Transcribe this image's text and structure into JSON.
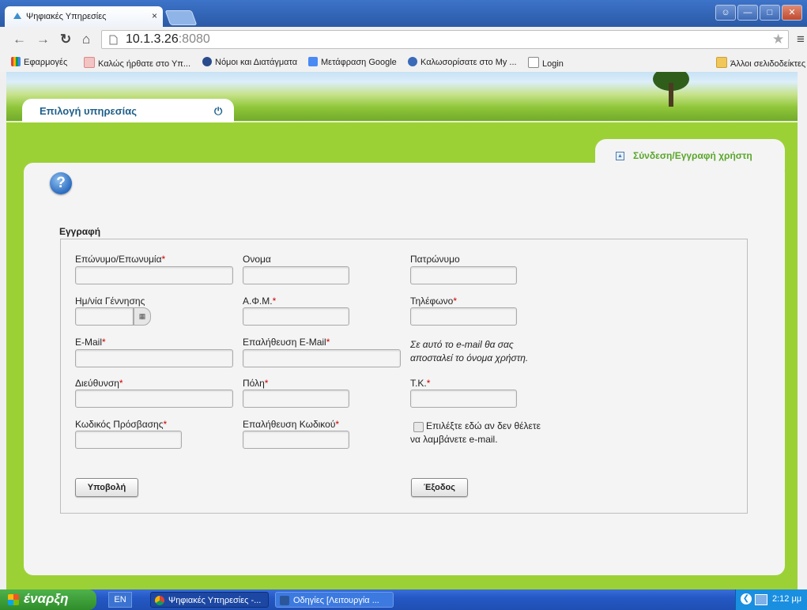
{
  "browser": {
    "tab_title": "Ψηφιακές Υπηρεσίες",
    "tab_close": "×",
    "url_host": "10.1.3.26",
    "url_port": ":8080",
    "bookmarks": [
      {
        "label": "Εφαρμογές",
        "icon": "apps-grid-icon",
        "color": "#e0453a"
      },
      {
        "label": "Καλώς ήρθατε στο Υπ...",
        "icon": "site-icon",
        "color": "#e79b9b"
      },
      {
        "label": "Νόμοι και Διατάγματα",
        "icon": "globe-icon",
        "color": "#2b4c8c"
      },
      {
        "label": "Μετάφραση Google",
        "icon": "translate-icon",
        "color": "#4a8af4"
      },
      {
        "label": "Καλωσορίσατε στο My ...",
        "icon": "globe-icon",
        "color": "#3a6ab8"
      },
      {
        "label": "Login",
        "icon": "page-icon",
        "color": "#ffffff"
      }
    ],
    "other_bookmarks": "Άλλοι σελιδοδείκτες"
  },
  "page": {
    "service_tab_label": "Επιλογή υπηρεσίας",
    "login_tab_label": "Σύνδεση/Εγγραφή χρήστη",
    "help_symbol": "?",
    "form_title": "Εγγραφή",
    "fields": {
      "surname": "Επώνυμο/Επωνυμία",
      "name": "Ονομα",
      "father_name": "Πατρώνυμο",
      "birth_date": "Ημ/νία Γέννησης",
      "afm": "Α.Φ.Μ.",
      "phone": "Τηλέφωνο",
      "email": "E-Mail",
      "email_confirm": "Επαλήθευση E-Mail",
      "address": "Διεύθυνση",
      "city": "Πόλη",
      "postal_code": "Τ.Κ.",
      "password": "Κωδικός Πρόσβασης",
      "password_confirm": "Επαλήθευση Κωδικού"
    },
    "required_mark": "*",
    "email_note": "Σε αυτό το e-mail θα σας αποσταλεί το όνομα χρήστη.",
    "no_email_checkbox_label": "Επιλέξτε εδώ αν δεν θέλετε να λαμβάνετε e-mail.",
    "submit_label": "Υποβολή",
    "exit_label": "Έξοδος"
  },
  "taskbar": {
    "start_label": "έναρξη",
    "language": "EN",
    "items": [
      {
        "label": "Ψηφιακές Υπηρεσίες -...",
        "icon": "chrome-icon"
      },
      {
        "label": "Οδηγίες [Λειτουργία ...",
        "icon": "word-doc-icon"
      }
    ],
    "clock": "2:12 μμ"
  },
  "colors": {
    "page_green": "#9cd136",
    "title_blue": "#1f5f8a",
    "login_green": "#5aa62a",
    "required_red": "#cc0000"
  }
}
